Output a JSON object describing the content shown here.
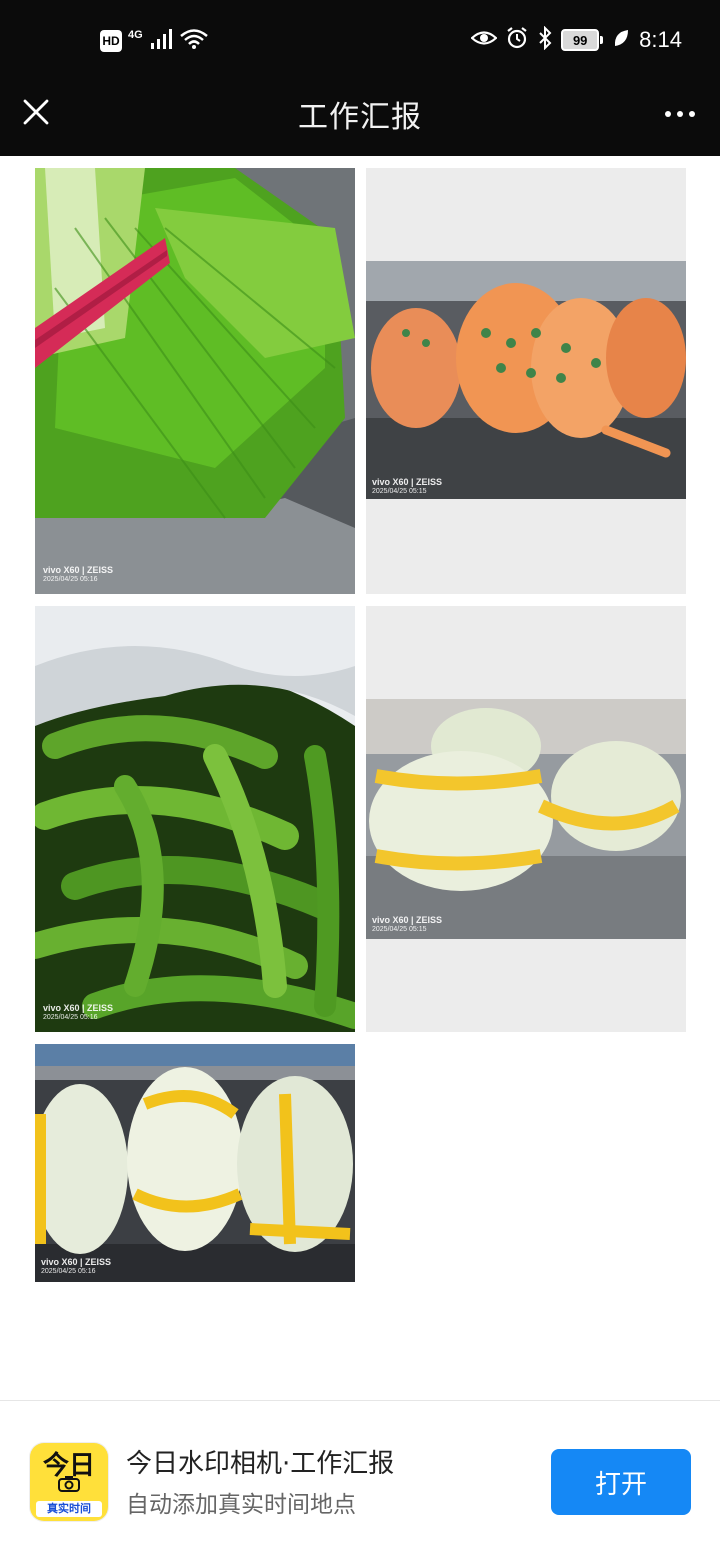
{
  "status_bar": {
    "hd": "HD",
    "network": "4G",
    "battery": "99",
    "time": "8:14"
  },
  "nav": {
    "title": "工作汇报",
    "close_icon": "close-icon",
    "more_icon": "more-icon"
  },
  "photos": [
    {
      "name": "chives",
      "watermark_brand": "vivo X60 | ZEISS",
      "watermark_date": "2025/04/25 05:16"
    },
    {
      "name": "carrots",
      "watermark_brand": "vivo X60 | ZEISS",
      "watermark_date": "2025/04/25 05:15"
    },
    {
      "name": "green-peppers",
      "watermark_brand": "vivo X60 | ZEISS",
      "watermark_date": "2025/04/25 05:16"
    },
    {
      "name": "napa-cabbage",
      "watermark_brand": "vivo X60 | ZEISS",
      "watermark_date": "2025/04/25 05:15"
    },
    {
      "name": "cabbage-shelf",
      "watermark_brand": "vivo X60 | ZEISS",
      "watermark_date": "2025/04/25 05:16"
    }
  ],
  "banner": {
    "icon_text_top": "今日",
    "icon_text_bottom": "真实时间",
    "app_name": "今日水印相机·工作汇报",
    "app_desc": "自动添加真实时间地点",
    "open_label": "打开"
  },
  "colors": {
    "bar_background": "#0b0b0b",
    "accent_blue": "#1588f5",
    "icon_yellow": "#ffe03a"
  }
}
